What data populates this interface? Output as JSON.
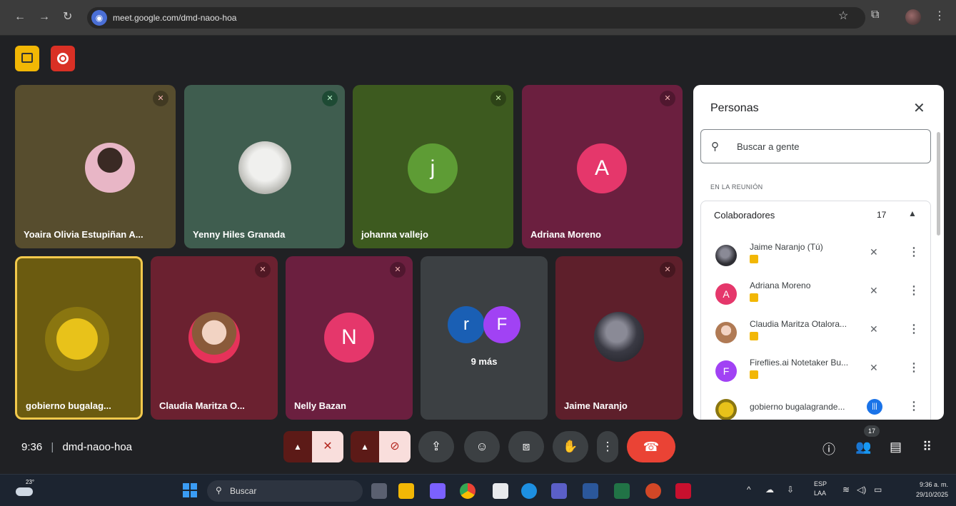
{
  "browser": {
    "url": "meet.google.com/dmd-naoo-hoa",
    "icons": [
      "back-icon",
      "forward-icon",
      "reload-icon",
      "star-icon",
      "extensions-icon",
      "menu-icon"
    ]
  },
  "meeting": {
    "tiles_row1": [
      {
        "name": "Yoaira Olivia Estupiñan A...",
        "type": "photo"
      },
      {
        "name": "Yenny Hiles Granada",
        "type": "photo"
      },
      {
        "name": "johanna vallejo",
        "type": "letter",
        "letter": "j",
        "color": "#5e9c35"
      },
      {
        "name": "Adriana Moreno",
        "type": "letter",
        "letter": "A",
        "color": "#e5376b"
      }
    ],
    "tiles_row2": [
      {
        "name": "gobierno bugalag...",
        "type": "logo"
      },
      {
        "name": "Claudia Maritza O...",
        "type": "photo"
      },
      {
        "name": "Nelly Bazan",
        "type": "letter",
        "letter": "N",
        "color": "#e5376b"
      },
      {
        "name": "Jaime Naranjo",
        "type": "photo"
      }
    ],
    "more_tile": {
      "letters": [
        "r",
        "F"
      ],
      "label": "9 más"
    }
  },
  "panel": {
    "title": "Personas",
    "search_placeholder": "Buscar a gente",
    "section": "EN LA REUNIÓN",
    "group_label": "Colaboradores",
    "group_count": "17",
    "people": [
      {
        "name": "Jaime Naranjo (Tú)",
        "avatar": "photo",
        "color": "#444"
      },
      {
        "name": "Adriana Moreno",
        "avatar": "A",
        "color": "#e5376b"
      },
      {
        "name": "Claudia Maritza Otalora...",
        "avatar": "photo",
        "color": "#c9a27e"
      },
      {
        "name": "Fireflies.ai Notetaker Bu...",
        "avatar": "F",
        "color": "#a142f4"
      },
      {
        "name": "gobierno bugalagrande...",
        "avatar": "logo",
        "color": "#d4b200"
      }
    ]
  },
  "bottom": {
    "time": "9:36",
    "separator": "|",
    "code": "dmd-naoo-hoa",
    "people_badge": "17"
  },
  "taskbar": {
    "temp": "23°",
    "search": "Buscar",
    "lang1": "ESP",
    "lang2": "LAA",
    "time": "9:36 a. m.",
    "date": "29/10/2025"
  }
}
